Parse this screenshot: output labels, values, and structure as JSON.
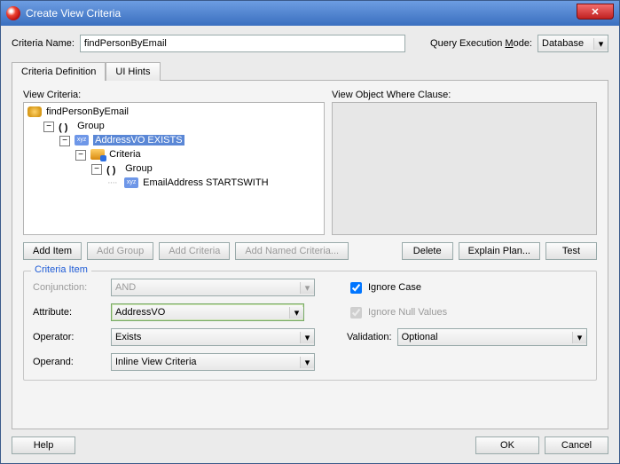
{
  "window": {
    "title": "Create View Criteria"
  },
  "header": {
    "criteria_name_label": "Criteria Name:",
    "criteria_name_value": "findPersonByEmail",
    "exec_mode_label_pre": "Query Execution ",
    "exec_mode_label_mn": "M",
    "exec_mode_label_post": "ode:",
    "exec_mode_value": "Database"
  },
  "tabs": {
    "definition": "Criteria Definition",
    "ui_hints": "UI Hints"
  },
  "vc": {
    "heading_pre": "View ",
    "heading_mn": "C",
    "heading_post": "riteria:",
    "root": "findPersonByEmail",
    "group": "Group",
    "node_selected": "AddressVO EXISTS",
    "criteria": "Criteria",
    "group2": "Group",
    "leaf": "EmailAddress STARTSWITH",
    "where_heading_pre": "View Object ",
    "where_heading_mn": "W",
    "where_heading_post": "here Clause:"
  },
  "buttons": {
    "add_item": "Add Item",
    "add_group": "Add Group",
    "add_criteria": "Add Criteria",
    "add_named": "Add Named Criteria...",
    "delete": "Delete",
    "explain": "Explain Plan...",
    "test": "Test"
  },
  "criteria_item": {
    "legend": "Criteria Item",
    "conjunction_label": "Conjunction:",
    "conjunction_value": "AND",
    "attribute_label": "Attribute:",
    "attribute_value": "AddressVO",
    "operator_label": "Operator:",
    "operator_value": "Exists",
    "operand_label": "Operand:",
    "operand_value": "Inline View Criteria",
    "ignore_case_pre": "Ignore ",
    "ignore_case_mn": "C",
    "ignore_case_post": "ase",
    "ignore_null_pre": "Igno",
    "ignore_null_mn": "r",
    "ignore_null_post": "e Null Values",
    "validation_label": "Validation:",
    "validation_value": "Optional"
  },
  "footer": {
    "help": "Help",
    "ok": "OK",
    "cancel": "Cancel"
  }
}
